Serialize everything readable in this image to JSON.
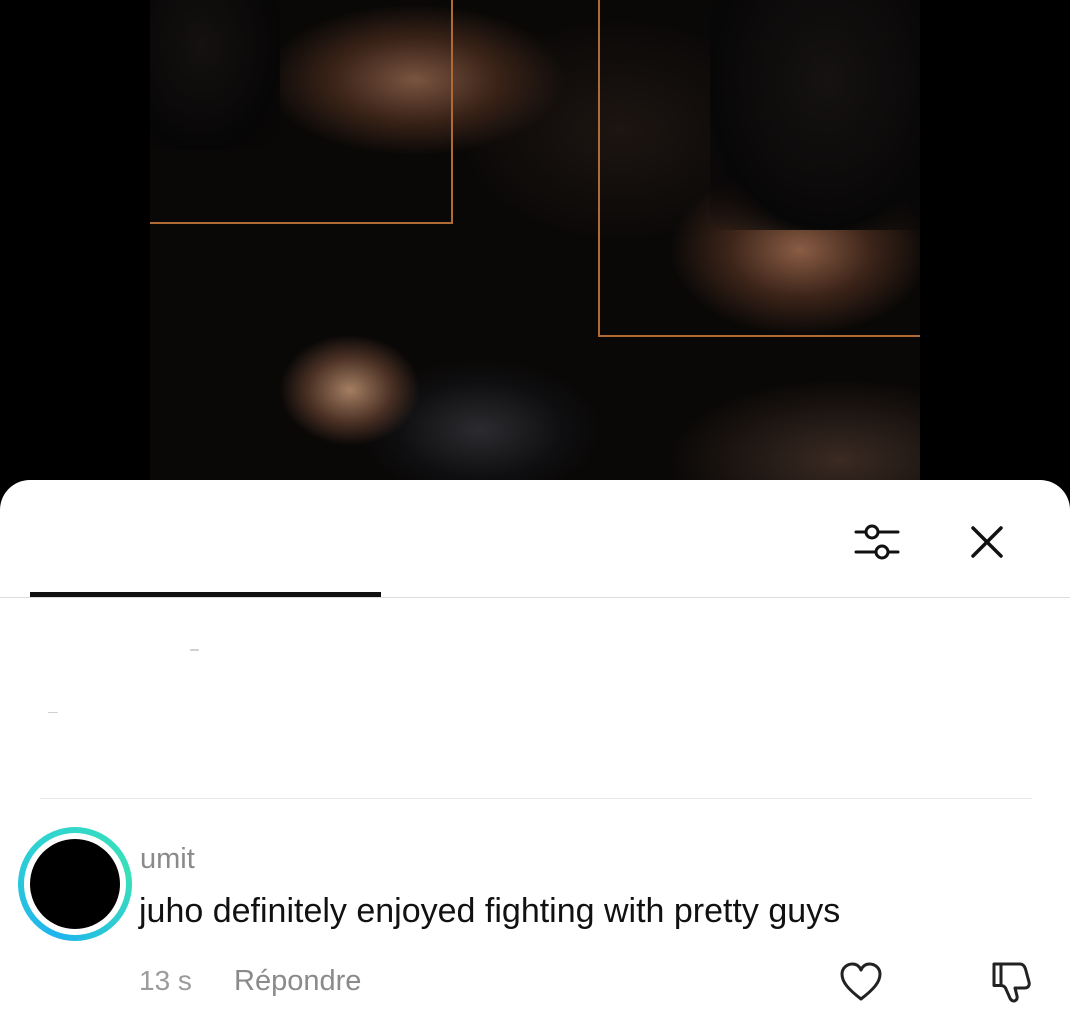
{
  "media": {
    "icon": "photo-collage"
  },
  "sheet": {
    "header": {
      "filter_icon": "sliders-icon",
      "close_icon": "close-icon"
    }
  },
  "comment": {
    "username": "umit",
    "text": "juho definitely enjoyed fighting with pretty guys",
    "timestamp": "13 s",
    "reply_label": "Répondre",
    "like_icon": "heart-outline-icon",
    "dislike_icon": "thumbs-down-icon"
  },
  "colors": {
    "frame": "#b06a33",
    "avatar_ring_start": "#1fb4ee",
    "avatar_ring_end": "#38e0b8",
    "tab_indicator": "#111111"
  }
}
